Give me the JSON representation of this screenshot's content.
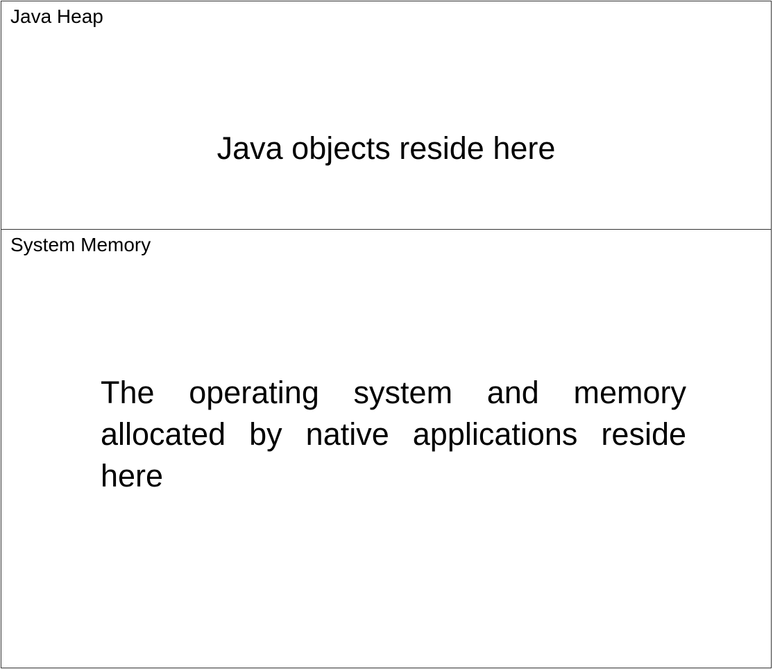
{
  "regions": {
    "heap": {
      "label": "Java Heap",
      "description": "Java objects reside here"
    },
    "system": {
      "label": "System Memory",
      "description": "The operating system and memory allocated by native applications reside here"
    }
  },
  "colors": {
    "border": "#333333",
    "background": "#ffffff",
    "text": "#000000"
  }
}
